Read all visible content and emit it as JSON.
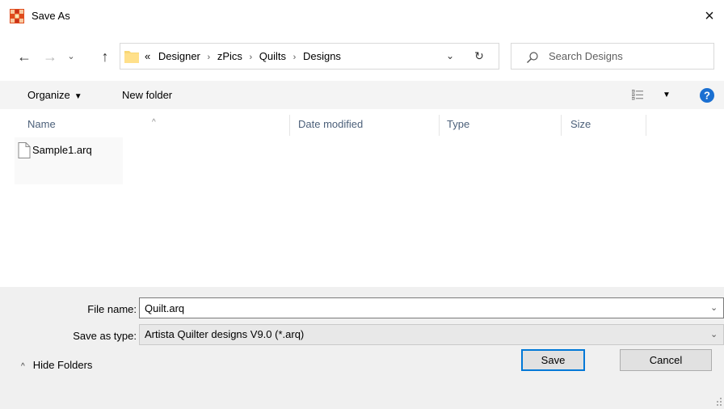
{
  "window": {
    "title": "Save As",
    "close_glyph": "×",
    "app_icon": "quilt-app-icon"
  },
  "nav": {
    "back_glyph": "←",
    "forward_glyph": "→",
    "recent_glyph": "⌄",
    "up_glyph": "↑"
  },
  "address": {
    "overflow": "«",
    "crumbs": [
      "Designer",
      "zPics",
      "Quilts",
      "Designs"
    ],
    "separator": "›",
    "dropdown_glyph": "⌄",
    "refresh_glyph": "↻"
  },
  "search": {
    "placeholder": "Search Designs",
    "value": ""
  },
  "toolbar": {
    "organize_label": "Organize",
    "organize_caret": "▼",
    "new_folder_label": "New folder",
    "view_caret": "▼",
    "help_icon": "help-icon"
  },
  "columns": {
    "name": "Name",
    "date_modified": "Date modified",
    "type": "Type",
    "size": "Size",
    "sort_indicator": "^"
  },
  "files": [
    {
      "name": "Sample1.arq"
    }
  ],
  "form": {
    "file_name_label": "File name:",
    "file_name_value": "Quilt.arq",
    "save_as_type_label": "Save as type:",
    "save_as_type_value": "Artista Quilter designs V9.0 (*.arq)",
    "dropdown_glyph": "⌄"
  },
  "footer": {
    "hide_folders_label": "Hide Folders",
    "hide_folders_glyph": "^",
    "save_label": "Save",
    "cancel_label": "Cancel"
  },
  "colors": {
    "accent": "#0078d7",
    "toolbar_bg": "#f4f4f4",
    "footer_bg": "#f0f0f0",
    "header_text": "#4c607a"
  }
}
